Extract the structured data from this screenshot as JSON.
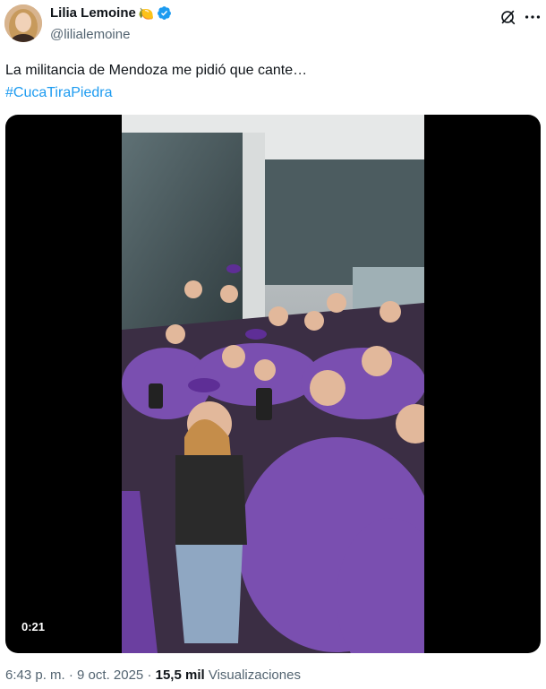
{
  "author": {
    "display_name": "Lilia Lemoine",
    "name_emoji": "🍋",
    "handle": "@lilialemoine",
    "verified": true,
    "verified_color": "#1d9bf0"
  },
  "actions": {
    "grok_icon": "grok-icon",
    "more_icon": "more-icon"
  },
  "tweet": {
    "text": "La militancia de Mendoza me pidió que cante…",
    "hashtag": "#CucaTiraPiedra",
    "hashtag_color": "#1d9bf0"
  },
  "media": {
    "type": "video",
    "duration": "0:21"
  },
  "meta": {
    "time": "6:43 p. m.",
    "separator1": " · ",
    "date": "9 oct. 2025",
    "separator2": " · ",
    "views_count": "15,5 mil",
    "views_label": "Visualizaciones"
  },
  "colors": {
    "text_primary": "#0f1419",
    "text_secondary": "#536471",
    "brand": "#1d9bf0"
  }
}
